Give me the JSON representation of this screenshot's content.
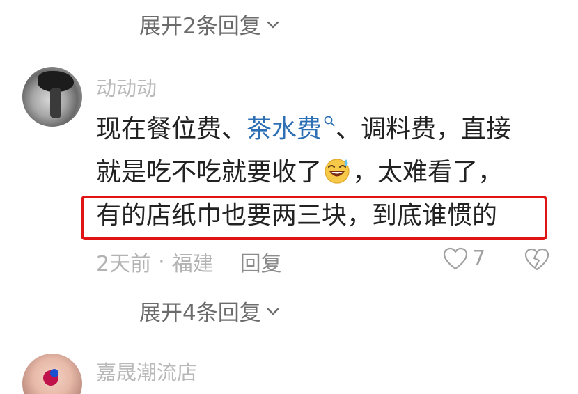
{
  "thread": {
    "expand_replies_1": "展开2条回复",
    "expand_replies_2": "展开4条回复"
  },
  "comment": {
    "username": "动动动",
    "line1_prefix": "现在餐位费、",
    "line1_link": "茶水费",
    "line1_suffix": "、调料费，直接",
    "line2_prefix": "就是吃不吃就要收了",
    "line2_suffix": "，太难看了，",
    "line3": "有的店纸巾也要两三块，到底谁惯的",
    "time": "2天前",
    "separator": "·",
    "location": "福建",
    "reply_label": "回复",
    "like_count": "7",
    "emoji": "laughing-with-sweat-emoji",
    "link_icon": "search-icon",
    "highlight_color": "#e01414",
    "link_color": "#2c6fb4"
  },
  "next_comment": {
    "username": "嘉晟潮流店"
  }
}
